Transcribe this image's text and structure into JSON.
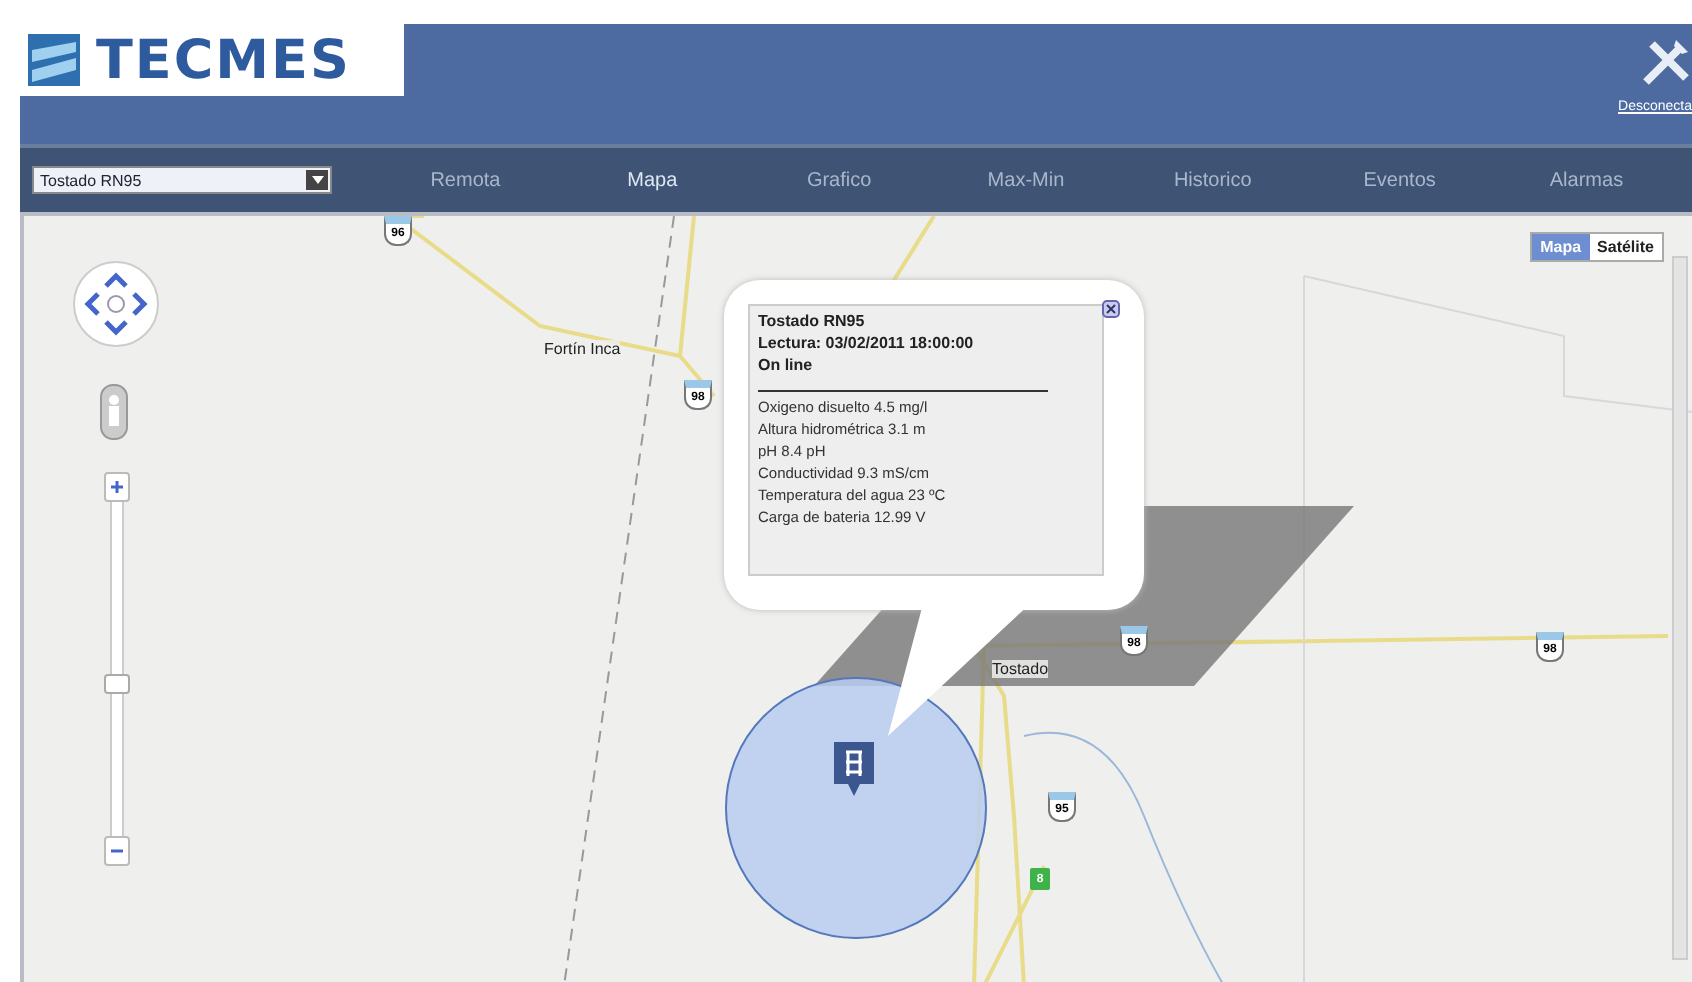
{
  "header": {
    "logo_text": "TECMES",
    "logout_link": "Desconecta"
  },
  "nav": {
    "station_select": "Tostado RN95",
    "items": [
      {
        "label": "Remota",
        "selected": false
      },
      {
        "label": "Mapa",
        "selected": true
      },
      {
        "label": "Grafico",
        "selected": false
      },
      {
        "label": "Max-Min",
        "selected": false
      },
      {
        "label": "Historico",
        "selected": false
      },
      {
        "label": "Eventos",
        "selected": false
      },
      {
        "label": "Alarmas",
        "selected": false
      }
    ]
  },
  "map": {
    "type_buttons": [
      {
        "label": "Mapa",
        "selected": true
      },
      {
        "label": "Satélite",
        "selected": false
      }
    ],
    "zoom": {
      "level": 0.47
    },
    "place_labels": [
      "Fortín Inca",
      "Tostado"
    ],
    "route_shields": [
      {
        "number": "96",
        "kind": "provincial"
      },
      {
        "number": "98",
        "kind": "provincial"
      },
      {
        "number": "98",
        "kind": "provincial"
      },
      {
        "number": "98",
        "kind": "provincial"
      },
      {
        "number": "95",
        "kind": "provincial"
      },
      {
        "number": "8",
        "kind": "national"
      }
    ],
    "info_window": {
      "station": "Tostado RN95",
      "reading_time": "Lectura: 03/02/2011 18:00:00",
      "status": "On line",
      "readings": [
        "Oxigeno disuelto 4.5 mg/l",
        "Altura hidrométrica 3.1 m",
        "pH 8.4 pH",
        "Conductividad 9.3 mS/cm",
        "Temperatura del agua 23 ºC",
        "Carga de bateria 12.99 V"
      ]
    }
  }
}
